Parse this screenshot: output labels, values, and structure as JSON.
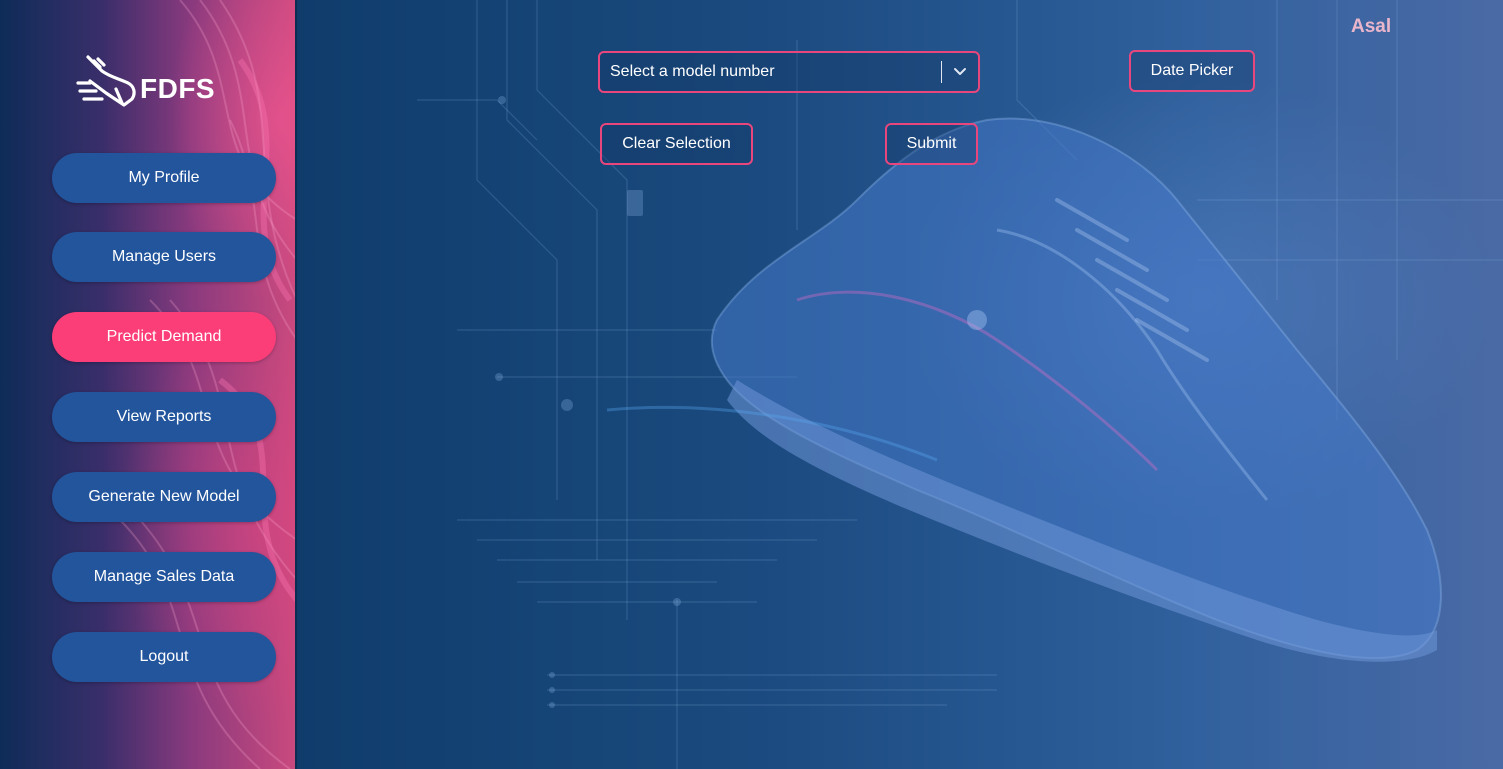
{
  "app": {
    "logo_text": "FDFS",
    "user_name": "Asal"
  },
  "sidebar": {
    "items": [
      {
        "label": "My Profile"
      },
      {
        "label": "Manage Users"
      },
      {
        "label": "Predict Demand",
        "active": true
      },
      {
        "label": "View Reports"
      },
      {
        "label": "Generate New Model"
      },
      {
        "label": "Manage Sales Data"
      },
      {
        "label": "Logout"
      }
    ]
  },
  "form": {
    "model_select": {
      "placeholder": "Select a model number",
      "icon": "chevron-down-icon"
    },
    "date_picker_label": "Date Picker",
    "clear_label": "Clear Selection",
    "submit_label": "Submit"
  },
  "colors": {
    "accent": "#fb3d78",
    "nav_button": "#23559c",
    "border_accent": "#e8467d",
    "main_background": "#1b4b80"
  },
  "icons": {
    "logo": "running-shoe-icon",
    "background": "sneaker-illustration"
  }
}
